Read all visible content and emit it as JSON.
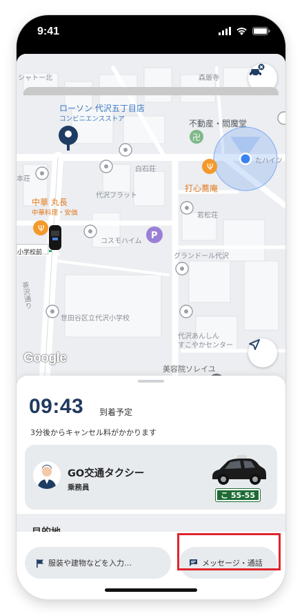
{
  "status_bar": {
    "time": "9:41"
  },
  "map": {
    "labels": {
      "lawson_name": "ローソン 代沢五丁目店",
      "lawson_type": "コンビニエンスストア",
      "fudosan": "不動産・閻魔堂",
      "moriyama": "森厳寺",
      "shiraishiso": "白石荘",
      "daizawa_flat": "代沢フラット",
      "chuka_name": "中華 丸長",
      "chuka_type": "中華料理・安価",
      "dashin": "打心蕎庵",
      "wakamatsuso": "若松荘",
      "cosmoheim": "コスモハイム",
      "grand_doll": "グランドール代沢",
      "school_front": "小学校前",
      "school": "世田谷区立代沢小学校",
      "chazawa": "茶沢通り",
      "anshin1": "代沢あんしん",
      "anshin2": "すこやかセンター",
      "beauty": "美容院ソレイユ",
      "honso": "本荘",
      "shattle": "シャトー北",
      "hights": "たハイツ"
    },
    "google_logo": "Google"
  },
  "eta": {
    "time": "09:43",
    "suffix": "到着予定",
    "cancel_note": "3分後からキャンセル料がかかります"
  },
  "driver": {
    "company": "GO交通タクシー",
    "role": "乗務員",
    "plate": "こ 55-55"
  },
  "destination": {
    "heading": "目的地"
  },
  "actions": {
    "clothing_placeholder": "服装や建物などを入力…",
    "message_label": "メッセージ・通話"
  },
  "colors": {
    "accent_navy": "#213a5e",
    "plate_green": "#1d6b33",
    "highlight_red": "#e0242b"
  }
}
